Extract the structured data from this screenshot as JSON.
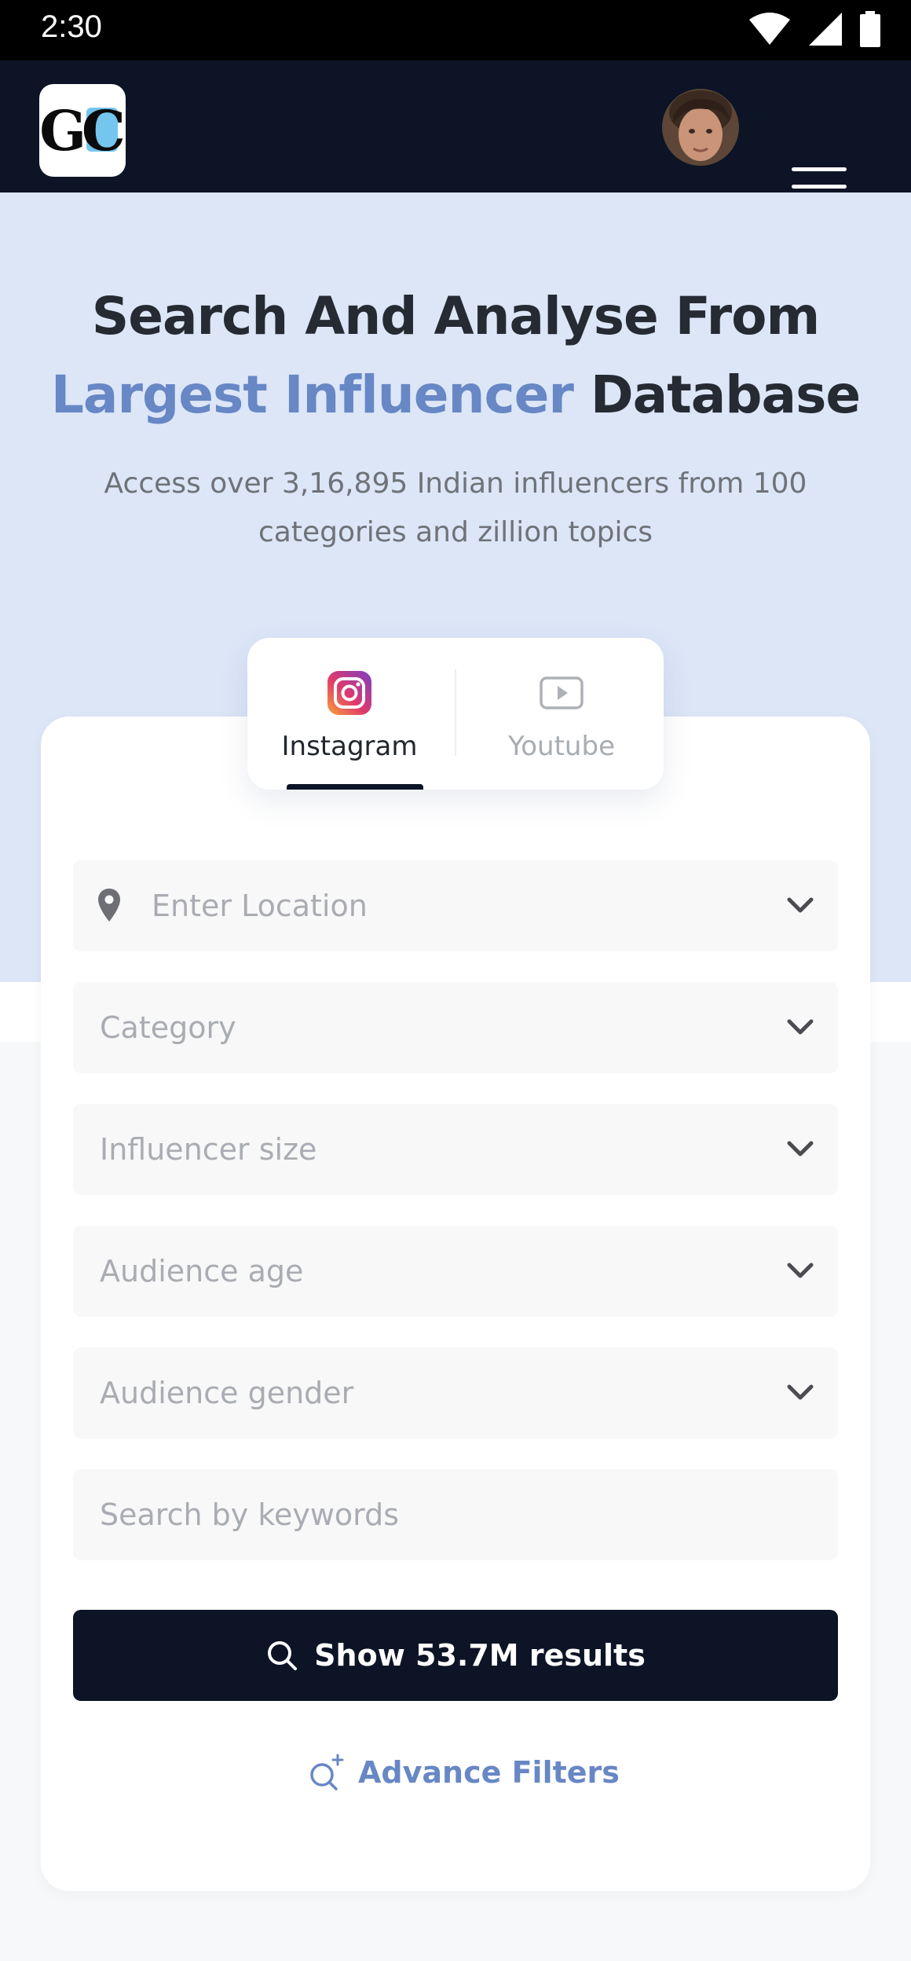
{
  "status_bar": {
    "time": "2:30"
  },
  "header": {
    "logo_text": "GC"
  },
  "hero": {
    "title_line1": "Search And Analyse From",
    "title_accent": "Largest Influencer",
    "title_end": "Database",
    "subtitle": "Access over 3,16,895 Indian influencers from 100 categories and zillion topics"
  },
  "tabs": [
    {
      "label": "Instagram",
      "icon": "instagram-icon",
      "active": true
    },
    {
      "label": "Youtube",
      "icon": "youtube-icon",
      "active": false
    }
  ],
  "form": {
    "location_placeholder": "Enter Location",
    "category_placeholder": "Category",
    "size_placeholder": "Influencer size",
    "age_placeholder": "Audience age",
    "gender_placeholder": "Audience gender",
    "keywords_placeholder": "Search by keywords",
    "submit_label": "Show 53.7M results",
    "advance_label": "Advance Filters"
  },
  "colors": {
    "navy": "#0c1426",
    "accent": "#6787c5",
    "hero_bg": "#dce6f7"
  }
}
